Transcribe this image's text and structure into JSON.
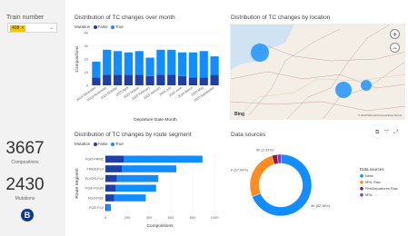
{
  "filter": {
    "title": "Train number",
    "chip": "408",
    "chip_close": "×",
    "dropdown": "⌄"
  },
  "kpis": [
    {
      "value": "3667",
      "label": "Compositions"
    },
    {
      "value": "2430",
      "label": "Mutations"
    }
  ],
  "logo": {
    "text": "B"
  },
  "colors": {
    "false": "#1f3fa6",
    "true": "#118dff",
    "nmbs": "#ff8c21",
    "fdr": "#8b1e3f",
    "msl": "#8a34c9",
    "accent": "#f1c40f"
  },
  "month_chart": {
    "title": "Distribution of TC changes over month",
    "legend_title": "Mutation",
    "chart_data": {
      "type": "bar",
      "stacked": true,
      "orientation": "vertical",
      "categories": [
        "2019 December",
        "2019 November",
        "2019 October",
        "2020 April",
        "2020 August",
        "2020 February",
        "2020 January",
        "2020 July",
        "2020 June",
        "2020 March",
        "2020 May",
        "2020 September"
      ],
      "series": [
        {
          "name": "False",
          "values": [
            6,
            8,
            8,
            8,
            8,
            7,
            8,
            8,
            7,
            6,
            6,
            8
          ]
        },
        {
          "name": "True",
          "values": [
            12,
            19,
            18,
            17,
            18,
            14,
            19,
            19,
            18,
            19,
            20,
            14
          ]
        }
      ],
      "ylim": [
        0,
        40
      ],
      "y_ticks": [
        "0",
        "10",
        "20",
        "30",
        "40"
      ],
      "xlabel": "Departure Date Month",
      "ylabel": "Compositions"
    }
  },
  "map_card": {
    "title": "Distribution of TC changes by location",
    "zoom_in": "+",
    "zoom_out": "−",
    "brand": "Bing",
    "copyright": "© 2020 Microsoft Corporation  Terms",
    "bubbles": [
      {
        "size": "large"
      },
      {
        "size": "large"
      },
      {
        "size": "medium"
      }
    ]
  },
  "segment_chart": {
    "title": "Distribution of TC changes by route segment",
    "legend_title": "Mutation",
    "chart_data": {
      "type": "bar",
      "stacked": true,
      "orientation": "horizontal",
      "categories": [
        "FGO-FRMZ",
        "FRMZ-FLV",
        "FLVGS-FLV",
        "FGE-FGUN",
        "FGO-FGE",
        "FGE-FLV"
      ],
      "series": [
        {
          "name": "False",
          "values": [
            170,
            150,
            105,
            95,
            80,
            10
          ]
        },
        {
          "name": "True",
          "values": [
            720,
            500,
            380,
            370,
            290,
            40
          ]
        }
      ],
      "xlim": [
        0,
        1000
      ],
      "x_ticks": [
        "0",
        "200",
        "400",
        "600",
        "800",
        "1000"
      ],
      "xlabel": "Compositions",
      "ylabel": "Route Segment"
    }
  },
  "donut_card": {
    "title": "Data sources",
    "icons": "⧉ ▽ ⤢ ⋯",
    "chart_data": {
      "type": "pie",
      "donut": true,
      "labels": [
        "Nbss",
        "MSL Raw",
        "FirstDepartures Raw",
        "MSL"
      ],
      "values": [
        2513,
        969,
        107,
        78
      ],
      "data_labels": [
        "3K (62.38%)",
        "1K (27.09%)",
        "0K (2.93%)",
        ""
      ]
    },
    "legend_title": "Data sources"
  }
}
